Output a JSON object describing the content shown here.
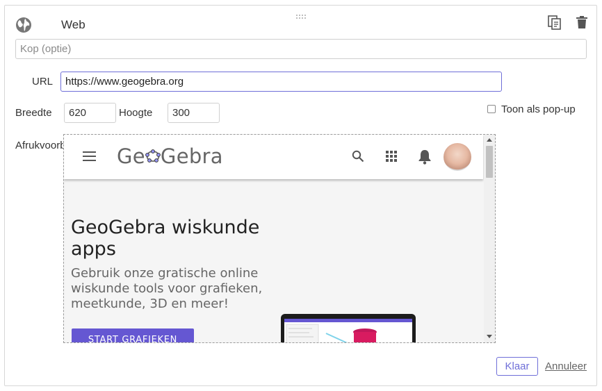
{
  "header": {
    "title": "Web"
  },
  "caption": {
    "placeholder": "Kop (optie)",
    "value": ""
  },
  "url": {
    "label": "URL",
    "value": "https://www.geogebra.org"
  },
  "size": {
    "width_label": "Breedte",
    "width_value": "620",
    "height_label": "Hoogte",
    "height_value": "300"
  },
  "popup": {
    "label": "Toon als pop-up",
    "checked": false
  },
  "preview": {
    "label": "Afrukvoorb",
    "site": {
      "logo_pre": "Ge",
      "logo_post": "Gebra",
      "hero_title": "GeoGebra wiskunde apps",
      "hero_subtitle": "Gebruik onze gratische online wiskunde tools voor grafieken, meetkunde, 3D en meer!",
      "cta_label": "START GRAFIEKEN"
    }
  },
  "footer": {
    "ok_label": "Klaar",
    "cancel_label": "Annuleer"
  },
  "colors": {
    "accent": "#6e6ed8",
    "geogebra_purple": "#6557d2",
    "trash": "#555555"
  },
  "icons": [
    "globe-icon",
    "copy-icon",
    "trash-icon",
    "menu-icon",
    "search-icon",
    "apps-grid-icon",
    "bell-icon"
  ]
}
